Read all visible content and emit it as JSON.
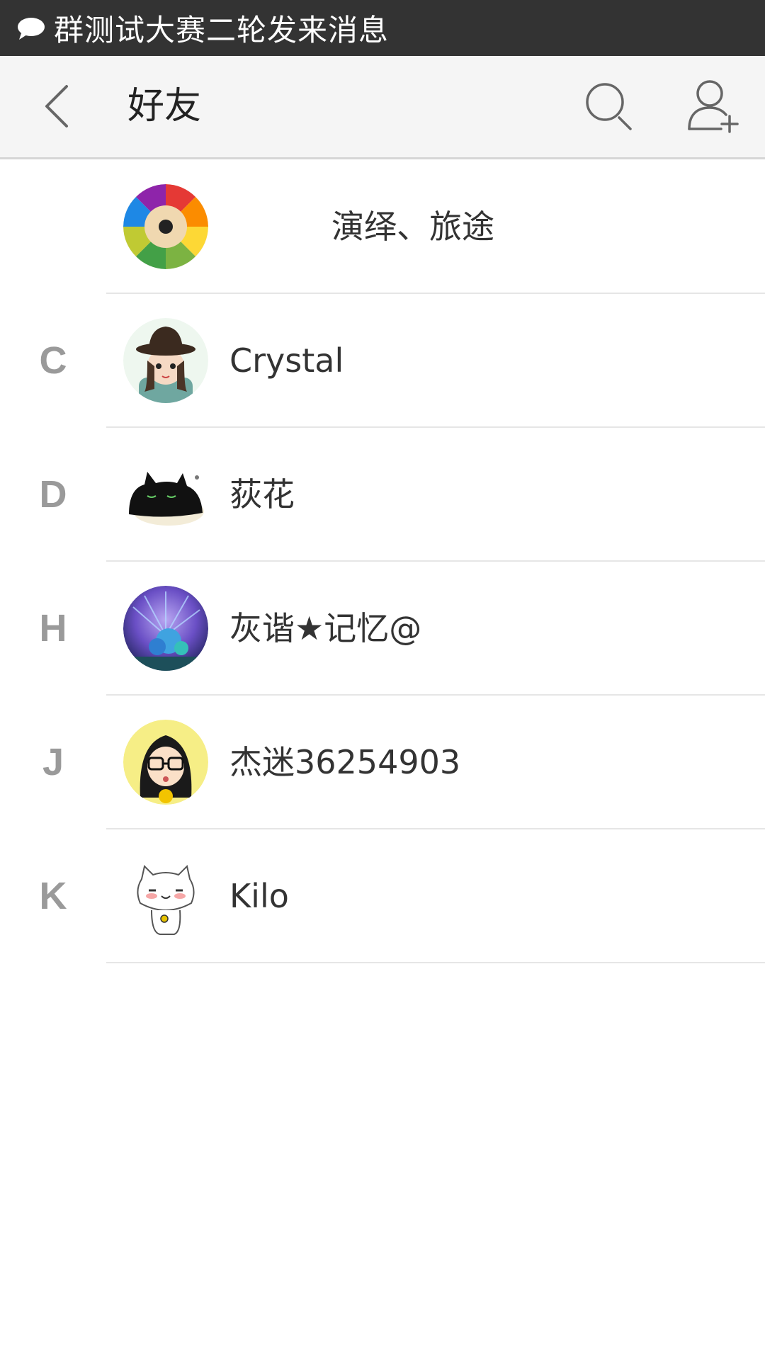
{
  "status_bar": {
    "icon": "chat-bubble-icon",
    "notification_text": "群测试大赛二轮发来消息"
  },
  "header": {
    "title": "好友",
    "back_icon": "chevron-left-icon",
    "search_icon": "search-icon",
    "add_friend_icon": "add-user-icon"
  },
  "friends": [
    {
      "letter": "",
      "name": "演绎、旅途",
      "avatar": "colored-pencils-avatar"
    },
    {
      "letter": "C",
      "name": "Crystal",
      "avatar": "girl-hat-avatar"
    },
    {
      "letter": "D",
      "name": "荻花",
      "avatar": "black-cat-avatar"
    },
    {
      "letter": "H",
      "name": "灰谐★记忆@",
      "avatar": "blue-flower-avatar"
    },
    {
      "letter": "J",
      "name": "杰迷36254903",
      "avatar": "cartoon-glasses-avatar"
    },
    {
      "letter": "K",
      "name": "Kilo",
      "avatar": "cartoon-cat-avatar"
    }
  ]
}
